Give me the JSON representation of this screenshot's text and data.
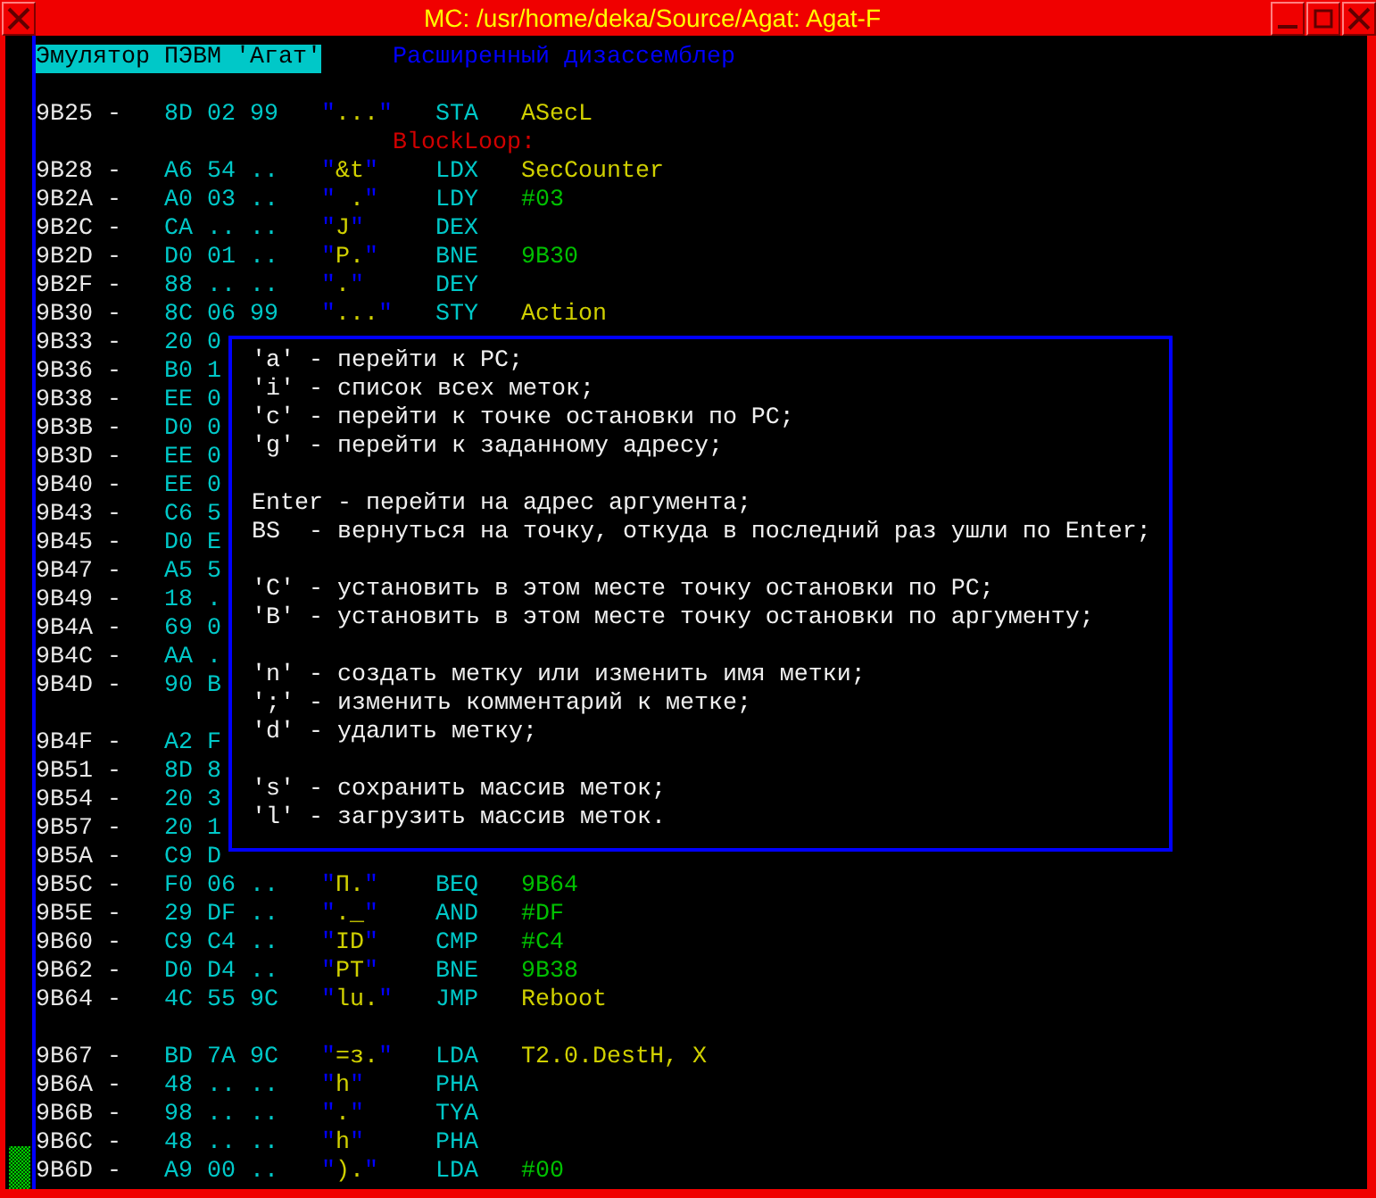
{
  "window": {
    "title": "MC: /usr/home/deka/Source/Agat: Agat-F"
  },
  "header": {
    "title": "Эмулятор ПЭВМ 'Агат'",
    "subtitle": "Расширенный дизассемблер"
  },
  "rows": [
    {
      "kind": "blank"
    },
    {
      "kind": "instruction",
      "address": "9B25",
      "dash": "-",
      "bytes": "8D 02 99",
      "ascii": "\"...\"",
      "mnemonic": "STA",
      "operand": {
        "text": "ASecL",
        "kind": "label"
      }
    },
    {
      "kind": "label",
      "text": "BlockLoop:"
    },
    {
      "kind": "instruction",
      "address": "9B28",
      "dash": "-",
      "bytes": "A6 54 ..",
      "ascii": "\"&t\"",
      "mnemonic": "LDX",
      "operand": {
        "text": "SecCounter",
        "kind": "label"
      }
    },
    {
      "kind": "instruction",
      "address": "9B2A",
      "dash": "-",
      "bytes": "A0 03 ..",
      "ascii": "\" .\"",
      "mnemonic": "LDY",
      "operand": {
        "text": "#03",
        "kind": "value"
      }
    },
    {
      "kind": "instruction",
      "address": "9B2C",
      "dash": "-",
      "bytes": "CA .. ..",
      "ascii": "\"J\"",
      "mnemonic": "DEX"
    },
    {
      "kind": "instruction",
      "address": "9B2D",
      "dash": "-",
      "bytes": "D0 01 ..",
      "ascii": "\"P.\"",
      "mnemonic": "BNE",
      "operand": {
        "text": "9B30",
        "kind": "value"
      }
    },
    {
      "kind": "instruction",
      "address": "9B2F",
      "dash": "-",
      "bytes": "88 .. ..",
      "ascii": "\".\"",
      "mnemonic": "DEY"
    },
    {
      "kind": "instruction",
      "address": "9B30",
      "dash": "-",
      "bytes": "8C 06 99",
      "ascii": "\"...\"",
      "mnemonic": "STY",
      "operand": {
        "text": "Action",
        "kind": "label"
      }
    },
    {
      "kind": "instruction",
      "address": "9B33",
      "dash": "-",
      "bytes": "20 0"
    },
    {
      "kind": "instruction",
      "address": "9B36",
      "dash": "-",
      "bytes": "B0 1"
    },
    {
      "kind": "instruction",
      "address": "9B38",
      "dash": "-",
      "bytes": "EE 0"
    },
    {
      "kind": "instruction",
      "address": "9B3B",
      "dash": "-",
      "bytes": "D0 0"
    },
    {
      "kind": "instruction",
      "address": "9B3D",
      "dash": "-",
      "bytes": "EE 0"
    },
    {
      "kind": "instruction",
      "address": "9B40",
      "dash": "-",
      "bytes": "EE 0"
    },
    {
      "kind": "instruction",
      "address": "9B43",
      "dash": "-",
      "bytes": "C6 5"
    },
    {
      "kind": "instruction",
      "address": "9B45",
      "dash": "-",
      "bytes": "D0 E"
    },
    {
      "kind": "instruction",
      "address": "9B47",
      "dash": "-",
      "bytes": "A5 5"
    },
    {
      "kind": "instruction",
      "address": "9B49",
      "dash": "-",
      "bytes": "18 ."
    },
    {
      "kind": "instruction",
      "address": "9B4A",
      "dash": "-",
      "bytes": "69 0"
    },
    {
      "kind": "instruction",
      "address": "9B4C",
      "dash": "-",
      "bytes": "AA ."
    },
    {
      "kind": "instruction",
      "address": "9B4D",
      "dash": "-",
      "bytes": "90 B"
    },
    {
      "kind": "blank"
    },
    {
      "kind": "instruction",
      "address": "9B4F",
      "dash": "-",
      "bytes": "A2 F"
    },
    {
      "kind": "instruction",
      "address": "9B51",
      "dash": "-",
      "bytes": "8D 8"
    },
    {
      "kind": "instruction",
      "address": "9B54",
      "dash": "-",
      "bytes": "20 3"
    },
    {
      "kind": "instruction",
      "address": "9B57",
      "dash": "-",
      "bytes": "20 1"
    },
    {
      "kind": "instruction",
      "address": "9B5A",
      "dash": "-",
      "bytes": "C9 D"
    },
    {
      "kind": "instruction",
      "address": "9B5C",
      "dash": "-",
      "bytes": "F0 06 ..",
      "ascii": "\"П.\"",
      "mnemonic": "BEQ",
      "operand": {
        "text": "9B64",
        "kind": "value"
      }
    },
    {
      "kind": "instruction",
      "address": "9B5E",
      "dash": "-",
      "bytes": "29 DF ..",
      "ascii": "\"._\"",
      "mnemonic": "AND",
      "operand": {
        "text": "#DF",
        "kind": "value"
      }
    },
    {
      "kind": "instruction",
      "address": "9B60",
      "dash": "-",
      "bytes": "C9 C4 ..",
      "ascii": "\"ID\"",
      "mnemonic": "CMP",
      "operand": {
        "text": "#C4",
        "kind": "value"
      }
    },
    {
      "kind": "instruction",
      "address": "9B62",
      "dash": "-",
      "bytes": "D0 D4 ..",
      "ascii": "\"PT\"",
      "mnemonic": "BNE",
      "operand": {
        "text": "9B38",
        "kind": "value"
      }
    },
    {
      "kind": "instruction",
      "address": "9B64",
      "dash": "-",
      "bytes": "4C 55 9C",
      "ascii": "\"lu.\"",
      "mnemonic": "JMP",
      "operand": {
        "text": "Reboot",
        "kind": "label"
      }
    },
    {
      "kind": "blank"
    },
    {
      "kind": "instruction",
      "address": "9B67",
      "dash": "-",
      "bytes": "BD 7A 9C",
      "ascii": "\"=з.\"",
      "mnemonic": "LDA",
      "operand": {
        "text": "T2.0.DestH, X",
        "kind": "label"
      }
    },
    {
      "kind": "instruction",
      "address": "9B6A",
      "dash": "-",
      "bytes": "48 .. ..",
      "ascii": "\"h\"",
      "mnemonic": "PHA"
    },
    {
      "kind": "instruction",
      "address": "9B6B",
      "dash": "-",
      "bytes": "98 .. ..",
      "ascii": "\".\"",
      "mnemonic": "TYA"
    },
    {
      "kind": "instruction",
      "address": "9B6C",
      "dash": "-",
      "bytes": "48 .. ..",
      "ascii": "\"h\"",
      "mnemonic": "PHA"
    },
    {
      "kind": "instruction",
      "address": "9B6D",
      "dash": "-",
      "bytes": "A9 00 ..",
      "ascii": "\").\"",
      "mnemonic": "LDA",
      "operand": {
        "text": "#00",
        "kind": "value"
      }
    }
  ],
  "help_popup": {
    "groups": [
      [
        "'a' - перейти к PC;",
        "'i' - список всех меток;",
        "'c' - перейти к точке остановки по PC;",
        "'g' - перейти к заданному адресу;"
      ],
      [
        "Enter - перейти на адрес аргумента;",
        "BS  - вернуться на точку, откуда в последний раз ушли по Enter;"
      ],
      [
        "'C' - установить в этом месте точку остановки по PC;",
        "'B' - установить в этом месте точку остановки по аргументу;"
      ],
      [
        "'n' - создать метку или изменить имя метки;",
        "';' - изменить комментарий к метке;",
        "'d' - удалить метку;"
      ],
      [
        "'s' - сохранить массив меток;",
        "'l' - загрузить массив меток."
      ]
    ]
  }
}
